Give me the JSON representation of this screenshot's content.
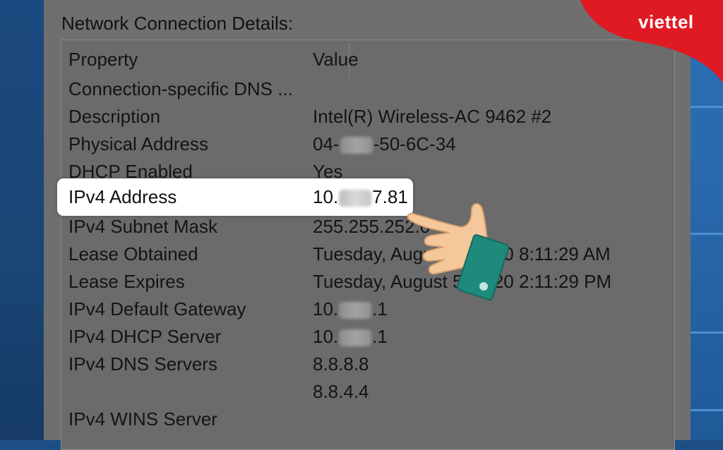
{
  "dialog": {
    "title": "Network Connection Details:",
    "columns": {
      "property": "Property",
      "value": "Value"
    },
    "rows": [
      {
        "property": "Connection-specific DNS ...",
        "value": ""
      },
      {
        "property": "Description",
        "value": "Intel(R) Wireless-AC 9462 #2"
      },
      {
        "property": "Physical Address",
        "value_start": "04-",
        "value_end": "-50-6C-34"
      },
      {
        "property": "DHCP Enabled",
        "value": "Yes"
      },
      {
        "property": "IPv4 Address",
        "value_start": "10.",
        "value_end": "7.81"
      },
      {
        "property": "IPv4 Subnet Mask",
        "value": "255.255.252.0"
      },
      {
        "property": "Lease Obtained",
        "value": "Tuesday, August 4, 2020 8:11:29 AM"
      },
      {
        "property": "Lease Expires",
        "value": "Tuesday, August 5, 2020 2:11:29 PM"
      },
      {
        "property": "IPv4 Default Gateway",
        "value_start": "10.",
        "value_end": ".1"
      },
      {
        "property": "IPv4 DHCP Server",
        "value_start": "10.",
        "value_end": ".1"
      },
      {
        "property": "IPv4 DNS Servers",
        "value": "8.8.8.8"
      },
      {
        "property": "",
        "value": "8.8.4.4"
      },
      {
        "property": "IPv4 WINS Server",
        "value": ""
      }
    ]
  },
  "brand": {
    "name": "viettel",
    "color": "#e01a22"
  },
  "colors": {
    "highlight": "#ffffff",
    "hand_skin": "#f5c89b",
    "hand_cuff": "#1f8a7c"
  },
  "overlay": {
    "pointer": "pointing-hand-icon"
  }
}
